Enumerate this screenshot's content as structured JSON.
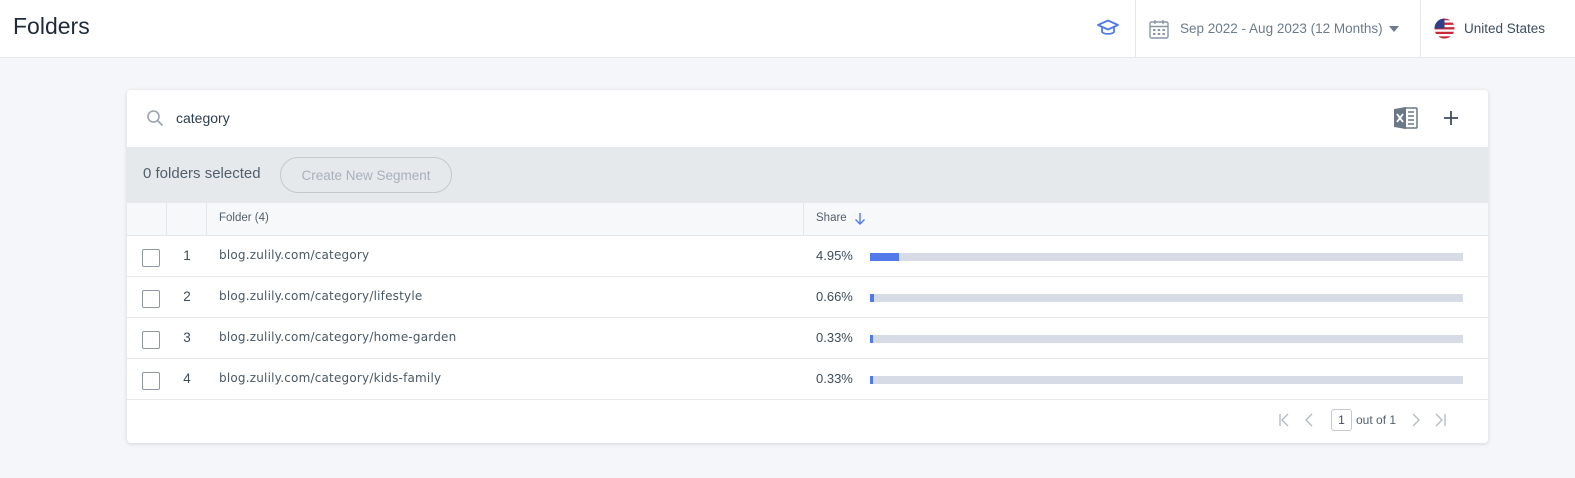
{
  "header": {
    "title": "Folders",
    "date_range": "Sep 2022 - Aug 2023 (12 Months)",
    "country": "United States"
  },
  "search": {
    "value": "category",
    "placeholder": "Search"
  },
  "selection": {
    "count_label": "0 folders selected",
    "segment_button": "Create New Segment"
  },
  "table": {
    "columns": [
      "Folder (4)",
      "Share"
    ],
    "rows": [
      {
        "index": "1",
        "folder": "blog.zulily.com/category",
        "share": "4.95%",
        "share_value": 4.95
      },
      {
        "index": "2",
        "folder": "blog.zulily.com/category/lifestyle",
        "share": "0.66%",
        "share_value": 0.66
      },
      {
        "index": "3",
        "folder": "blog.zulily.com/category/home-garden",
        "share": "0.33%",
        "share_value": 0.33
      },
      {
        "index": "4",
        "folder": "blog.zulily.com/category/kids-family",
        "share": "0.33%",
        "share_value": 0.33
      }
    ]
  },
  "pagination": {
    "page": "1",
    "out_of": "out of 1"
  },
  "colors": {
    "accent": "#4f7ae8",
    "bar_track": "#d7dbe6"
  },
  "icons": [
    "graduation-cap-icon",
    "calendar-icon",
    "us-flag-icon",
    "search-icon",
    "excel-export-icon",
    "add-icon",
    "sort-down-icon",
    "first-page-icon",
    "prev-page-icon",
    "next-page-icon",
    "last-page-icon"
  ]
}
